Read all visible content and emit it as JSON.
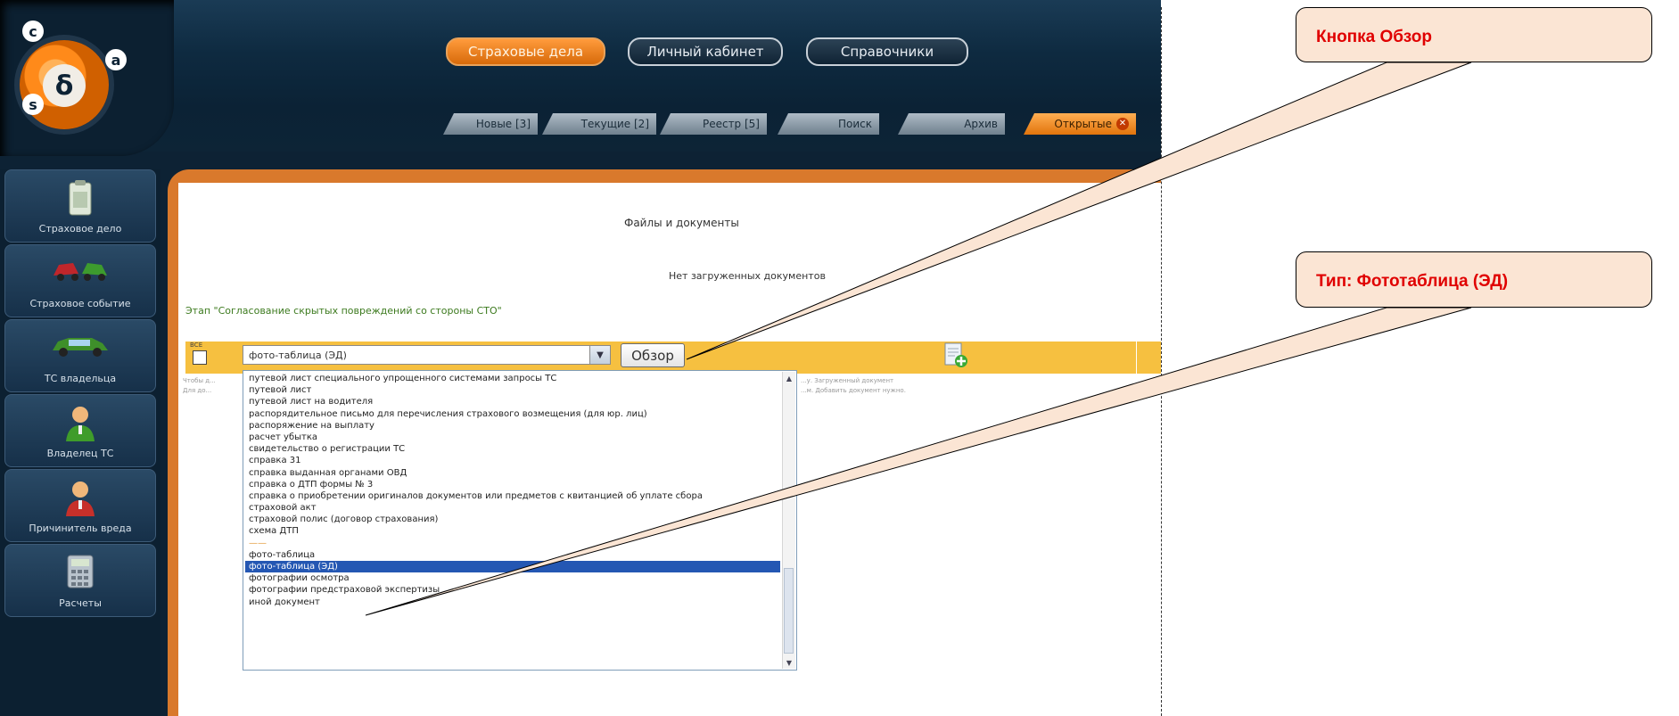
{
  "header": {
    "logo_letters": [
      "c",
      "δ",
      "s",
      "a"
    ],
    "top_tabs": [
      {
        "label": "Страховые дела",
        "active": true
      },
      {
        "label": "Личный кабинет",
        "active": false
      },
      {
        "label": "Справочники",
        "active": false
      }
    ],
    "sub_tabs": [
      {
        "label": "Новые [3]"
      },
      {
        "label": "Текущие [2]"
      },
      {
        "label": "Реестр [5]"
      },
      {
        "label": "Поиск"
      },
      {
        "label": "Архив"
      },
      {
        "label": "Открытые",
        "open": true
      }
    ]
  },
  "sidebar": {
    "items": [
      {
        "label": "Страховое дело",
        "icon": "folder-icon"
      },
      {
        "label": "Страховое событие",
        "icon": "car-crash-icon"
      },
      {
        "label": "ТС владельца",
        "icon": "car-icon"
      },
      {
        "label": "Владелец ТС",
        "icon": "person-icon"
      },
      {
        "label": "Причинитель вреда",
        "icon": "person-red-icon"
      },
      {
        "label": "Расчеты",
        "icon": "calculator-icon"
      }
    ]
  },
  "main": {
    "title": "Файлы и документы",
    "no_docs": "Нет загруженных документов",
    "stage": "Этап \"Согласование скрытых повреждений со стороны СТО\"",
    "all_label": "ВСЕ",
    "type_select_value": "фото-таблица (ЭД)",
    "browse_label": "Обзор",
    "hints": [
      "Чтобы д...",
      "Для до...",
      "...у. Загруженный документ",
      "...м. Добавить документ нужно."
    ]
  },
  "dropdown": {
    "options": [
      "путевой лист специального упрощенного системами запросы ТС",
      "путевой лист",
      "путевой лист на водителя",
      "распорядительное письмо для перечисления страхового возмещения (для юр. лиц)",
      "распоряжение на выплату",
      "расчет убытка",
      "свидетельство о регистрации ТС",
      "справка 31",
      "справка выданная органами ОВД",
      "справка о ДТП формы № 3",
      "справка о приобретении оригиналов документов или предметов с квитанцией об уплате сбора",
      "страховой акт",
      "страховой полис (договор страхования)",
      "схема ДТП",
      "——",
      "фото-таблица",
      "фото-таблица (ЭД)",
      "фотографии осмотра",
      "фотографии предстраховой экспертизы",
      "иной документ"
    ],
    "selected_index": 16,
    "muted_index": 14
  },
  "callouts": [
    {
      "text": "Кнопка Обзор"
    },
    {
      "text": "Тип:  Фототаблица (ЭД)"
    }
  ]
}
